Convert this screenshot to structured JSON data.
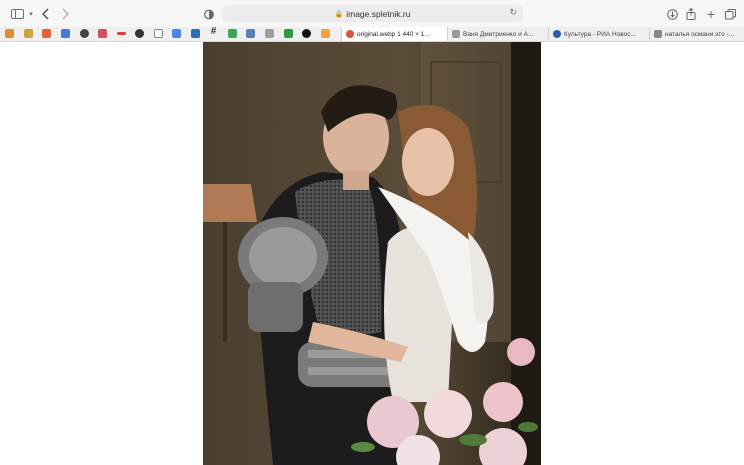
{
  "window": {
    "address": "image.spletnik.ru"
  },
  "tabs": [
    {
      "label": "original.webp 1 440 × 1...",
      "active": true
    },
    {
      "label": "Ваня Дмитриенко и А...",
      "active": false
    },
    {
      "label": "Культура - РИА Новос...",
      "active": false
    },
    {
      "label": "наталья османи это -...",
      "active": false
    }
  ],
  "icons": {
    "sidebar": "sidebar-icon",
    "back": "chevron-left-icon",
    "forward": "chevron-right-icon",
    "privacy": "shield-icon",
    "reload": "reload-icon",
    "download": "download-icon",
    "share": "share-icon",
    "new_tab": "plus-icon",
    "tabs_overview": "tabs-icon"
  },
  "colors": {
    "toolbar_bg": "#f6f6f6",
    "tab_active_bg": "#ffffff",
    "page_bg": "#ffffff"
  }
}
